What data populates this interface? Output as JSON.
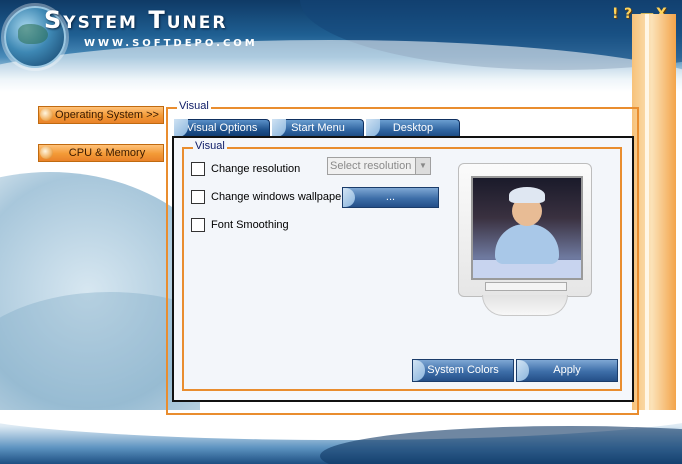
{
  "window": {
    "title": "System Tuner",
    "subtitle": "WWW.SOFTDEPO.COM",
    "controls": {
      "help": "!",
      "about": "?",
      "minimize": "—",
      "close": "X"
    }
  },
  "nav": {
    "items": [
      {
        "label": "Operating System >>",
        "icon": "bullet-arrow-icon"
      },
      {
        "label": "CPU & Memory",
        "icon": "bullet-arrow-icon"
      }
    ]
  },
  "main": {
    "group_label": "Visual",
    "tabs": [
      {
        "label": "Visual Options",
        "active": true
      },
      {
        "label": "Start Menu",
        "active": false
      },
      {
        "label": "Desktop",
        "active": false
      }
    ],
    "visual_group": {
      "label": "Visual",
      "options": [
        {
          "label": "Change resolution",
          "checked": false
        },
        {
          "label": "Change windows wallpaper",
          "checked": false
        },
        {
          "label": "Font Smoothing",
          "checked": false
        }
      ],
      "resolution_select": {
        "placeholder": "Select resolution",
        "enabled": false
      },
      "wallpaper_browse_label": "...",
      "preview_icon": "crt-monitor-baby-wallpaper"
    },
    "buttons": {
      "system_colors": "System Colors",
      "apply": "Apply"
    }
  },
  "colors": {
    "accent_orange": "#e98d2f",
    "header_blue": "#1f5f92",
    "button_blue": "#3d6ea8",
    "legend_text": "#0c1a66"
  }
}
